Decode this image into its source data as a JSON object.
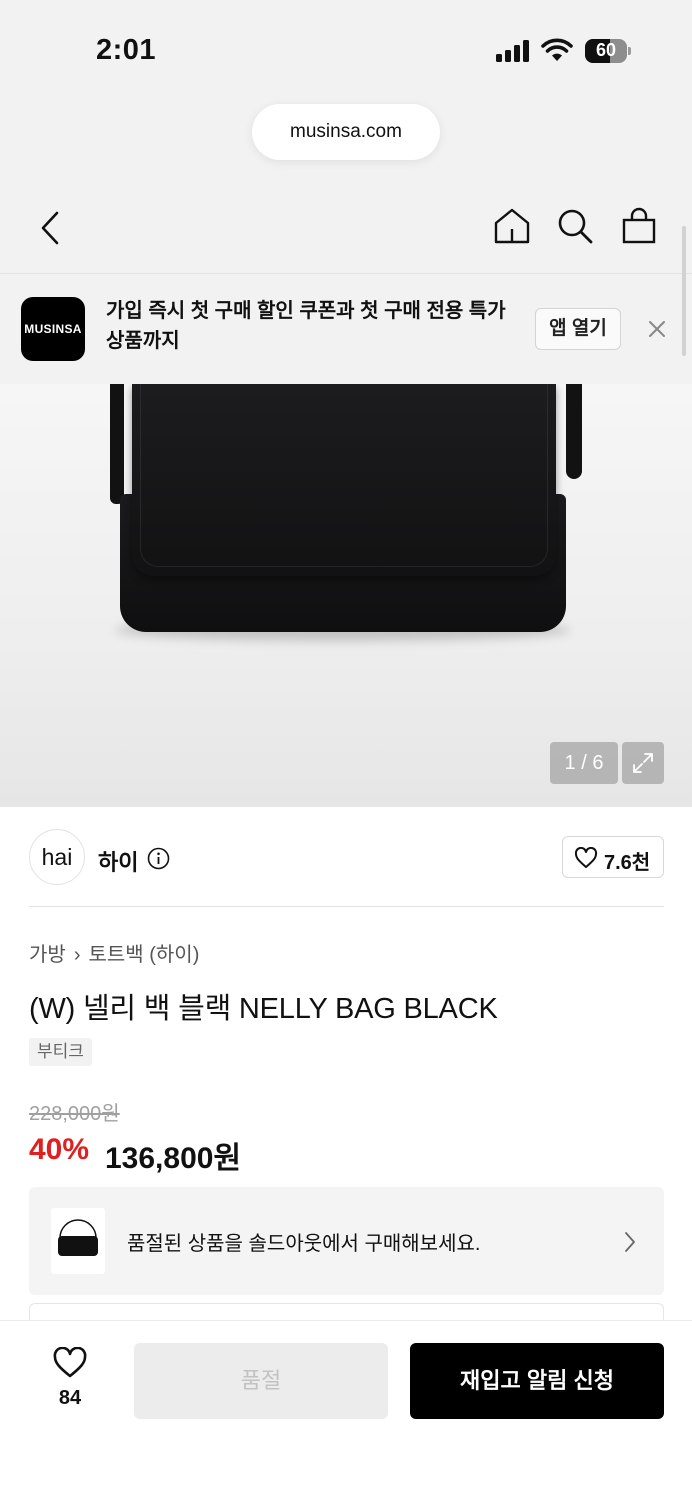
{
  "status_bar": {
    "time": "2:01",
    "battery_percent": "60",
    "battery_level": 0.6
  },
  "browser": {
    "url": "musinsa.com"
  },
  "app_banner": {
    "logo_text": "MUSINSA",
    "message": "가입 즉시 첫 구매 할인 쿠폰과 첫 구매 전용 특가 상품까지",
    "open_app_label": "앱 열기"
  },
  "gallery": {
    "counter": "1 / 6"
  },
  "brand": {
    "logo_text": "hai",
    "name": "하이",
    "likes": "7.6천"
  },
  "product": {
    "breadcrumb": [
      "가방",
      "토트백 (하이)"
    ],
    "title": "(W) 넬리 백 블랙 NELLY BAG BLACK",
    "tag": "부티크",
    "original_price": "228,000원",
    "discount": "40%",
    "sale_price": "136,800원"
  },
  "soldout_card": {
    "text": "품절된 상품을 솔드아웃에서 구매해보세요."
  },
  "bottom_bar": {
    "wish_count": "84",
    "soldout_label": "품절",
    "notify_label": "재입고 알림 신청"
  },
  "colors": {
    "accent_red": "#e02020",
    "primary_black": "#000000"
  }
}
